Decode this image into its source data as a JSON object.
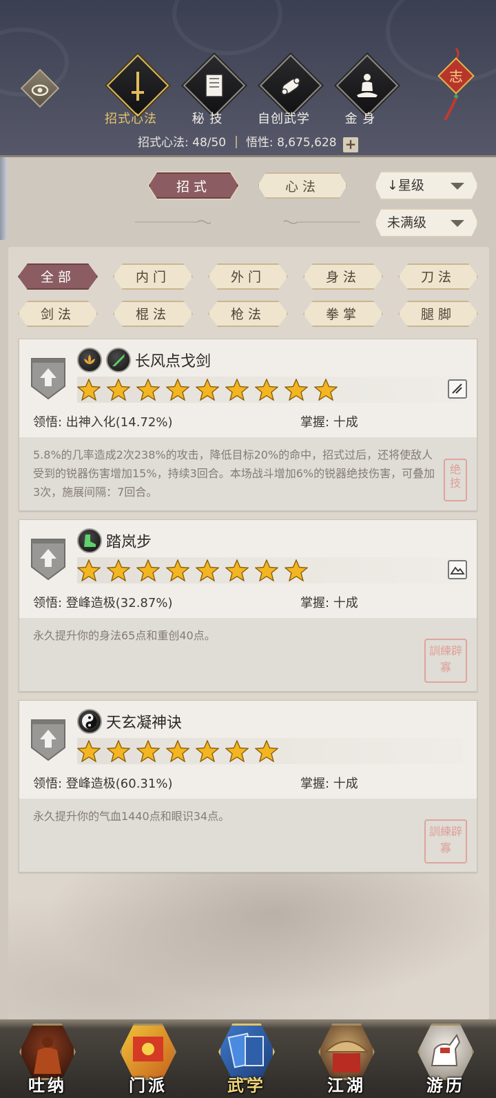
{
  "header": {
    "tabs": [
      {
        "label": "招式心法",
        "icon": "sword-icon",
        "active": true
      },
      {
        "label": "秘 技",
        "icon": "book-icon",
        "active": false
      },
      {
        "label": "自创武学",
        "icon": "scroll-icon",
        "active": false
      },
      {
        "label": "金 身",
        "icon": "meditation-icon",
        "active": false
      }
    ],
    "knot_char": "志",
    "stats": {
      "moves_label": "招式心法: 48/50",
      "insight_label": "悟性: 8,675,628",
      "plus": "+"
    }
  },
  "filters": {
    "primary_tabs": [
      {
        "label": "招式",
        "active": true
      },
      {
        "label": "心法",
        "active": false
      }
    ],
    "sort_dropdown": "↓星级",
    "level_dropdown": "未满级",
    "categories": [
      {
        "label": "全部",
        "active": true
      },
      {
        "label": "内门",
        "active": false
      },
      {
        "label": "外门",
        "active": false
      },
      {
        "label": "身法",
        "active": false
      },
      {
        "label": "刀法",
        "active": false
      },
      {
        "label": "剑法",
        "active": false
      },
      {
        "label": "棍法",
        "active": false
      },
      {
        "label": "枪法",
        "active": false
      },
      {
        "label": "拳掌",
        "active": false
      },
      {
        "label": "腿脚",
        "active": false
      }
    ]
  },
  "skills": [
    {
      "name": "长风点戈剑",
      "stars": 9,
      "comprehension": "领悟: 出神入化(14.72%)",
      "mastery": "掌握: 十成",
      "description": "5.8%的几率造成2次238%的攻击，降低目标20%的命中，招式过后，还将使敌人受到的锐器伤害增加15%，持续3回合。本场战斗增加6%的锐器绝技伤害，可叠加3次，施展间隔：7回合。",
      "seal": "绝技",
      "icons": [
        "lotus-icon",
        "blade-icon"
      ]
    },
    {
      "name": "踏岚步",
      "stars": 8,
      "comprehension": "领悟: 登峰造极(32.87%)",
      "mastery": "掌握: 十成",
      "description": "永久提升你的身法65点和重创40点。",
      "seal": "訓練辟寡",
      "icons": [
        "boot-icon"
      ]
    },
    {
      "name": "天玄凝神诀",
      "stars": 7,
      "comprehension": "领悟: 登峰造极(60.31%)",
      "mastery": "掌握: 十成",
      "description": "永久提升你的气血1440点和眼识34点。",
      "seal": "訓練辟寡",
      "icons": [
        "yin-yang-icon"
      ]
    }
  ],
  "bottom_nav": [
    {
      "label": "吐纳",
      "icon": "monk-icon",
      "active": false
    },
    {
      "label": "门派",
      "icon": "banner-icon",
      "active": false
    },
    {
      "label": "武学",
      "icon": "scripture-icon",
      "active": true
    },
    {
      "label": "江湖",
      "icon": "straw-hat-icon",
      "active": false
    },
    {
      "label": "游历",
      "icon": "horse-icon",
      "active": false
    }
  ],
  "colors": {
    "accent_active": "#8b5d62",
    "gold": "#e6c46a",
    "star": "#f2b824"
  }
}
